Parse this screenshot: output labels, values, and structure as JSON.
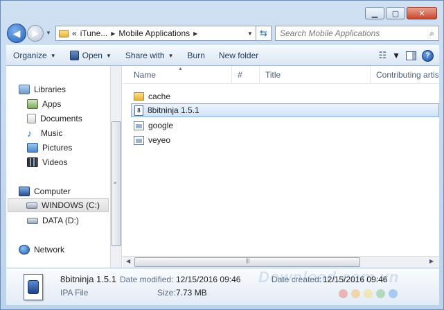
{
  "window": {
    "minimize_glyph": "▁",
    "maximize_glyph": "▢",
    "close_glyph": "✕"
  },
  "nav": {
    "back_glyph": "◀",
    "forward_glyph": "▶",
    "history_glyph": "▼",
    "breadcrumb_overflow": "«",
    "breadcrumb": [
      "iTune...",
      "Mobile Applications"
    ],
    "crumb_separator": "▶",
    "address_dropdown": "▼",
    "refresh_glyph": "⇆",
    "search_placeholder": "Search Mobile Applications",
    "search_icon": "⌕"
  },
  "toolbar": {
    "organize": "Organize",
    "open": "Open",
    "share_with": "Share with",
    "burn": "Burn",
    "new_folder": "New folder",
    "dropdown_glyph": "▼",
    "views_glyph": "☷",
    "help_glyph": "?"
  },
  "sidebar": {
    "libraries": "Libraries",
    "library_items": [
      "Apps",
      "Documents",
      "Music",
      "Pictures",
      "Videos"
    ],
    "music_glyph": "♪",
    "computer": "Computer",
    "drives": [
      "WINDOWS (C:)",
      "DATA (D:)"
    ],
    "network": "Network",
    "scroll_grip": "≡"
  },
  "columns": {
    "name": "Name",
    "number": "#",
    "title": "Title",
    "contributing_artists": "Contributing artis",
    "sort_glyph": "▲"
  },
  "files": [
    {
      "name": "cache",
      "kind": "folder"
    },
    {
      "name": "8bitninja 1.5.1",
      "kind": "ipa"
    },
    {
      "name": "google",
      "kind": "generic"
    },
    {
      "name": "veyeo",
      "kind": "generic"
    }
  ],
  "file_icon_ipa": "8",
  "hscroll": {
    "left": "◀",
    "right": "▶",
    "grip": "|||"
  },
  "details": {
    "name": "8bitninja 1.5.1",
    "type": "IPA File",
    "date_modified_label": "Date modified:",
    "date_modified": "12/15/2016 09:46",
    "size_label": "Size:",
    "size": "7.73 MB",
    "date_created_label": "Date created:",
    "date_created": "12/15/2016 09:46"
  },
  "watermark": "Download.com.vn",
  "watermark_dots": [
    "#e94b3c",
    "#f5a623",
    "#f8d347",
    "#4caf50",
    "#2f80ed"
  ],
  "colors": {
    "selection_border": "#84acdd",
    "accent": "#1f5fb7"
  }
}
